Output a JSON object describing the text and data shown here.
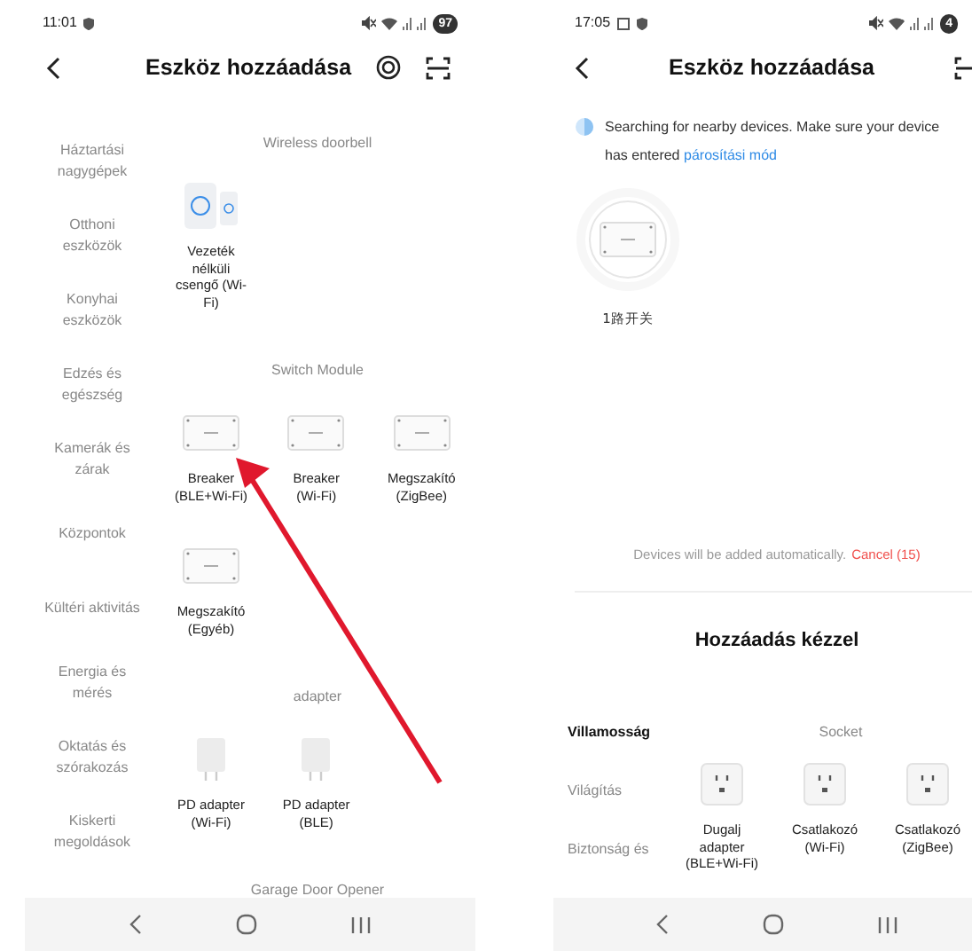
{
  "left_screen": {
    "status_bar": {
      "time": "11:01",
      "battery": "97"
    },
    "title": "Eszköz hozzáadása",
    "categories": [
      {
        "label": "Háztartási nagygépek",
        "selected": false
      },
      {
        "label": "Otthoni eszközök",
        "selected": false
      },
      {
        "label": "Konyhai eszközök",
        "selected": false
      },
      {
        "label": "Edzés és egészség",
        "selected": false
      },
      {
        "label": "Kamerák és zárak",
        "selected": false
      },
      {
        "label": "Központok",
        "selected": false
      },
      {
        "label": "Kültéri aktivitás",
        "selected": false
      },
      {
        "label": "Energia és mérés",
        "selected": false
      },
      {
        "label": "Oktatás és szórakozás",
        "selected": false
      },
      {
        "label": "Kiskerti megoldások",
        "selected": false
      }
    ],
    "sections": [
      {
        "title": "Wireless doorbell",
        "items": [
          {
            "label": "Vezeték nélküli csengő (Wi-Fi)",
            "kind": "doorbell"
          }
        ]
      },
      {
        "title": "Switch Module",
        "items": [
          {
            "label": "Breaker (BLE+Wi-Fi)",
            "kind": "breaker"
          },
          {
            "label": "Breaker (Wi-Fi)",
            "kind": "breaker"
          },
          {
            "label": "Megszakító (ZigBee)",
            "kind": "breaker"
          },
          {
            "label": "Megszakító (Egyéb)",
            "kind": "breaker"
          }
        ]
      },
      {
        "title": "adapter",
        "items": [
          {
            "label": "PD adapter (Wi-Fi)",
            "kind": "adapter"
          },
          {
            "label": "PD adapter (BLE)",
            "kind": "adapter"
          }
        ]
      },
      {
        "title": "Garage Door Opener"
      }
    ]
  },
  "right_screen": {
    "status_bar": {
      "time": "17:05",
      "battery": "4"
    },
    "title": "Eszköz hozzáadása",
    "search_message": "Searching for nearby devices. Make sure your device has entered",
    "pairing_link": "párosítási mód",
    "found_devices": [
      {
        "label": "1路开关"
      }
    ],
    "auto_add_text": "Devices will be added automatically.",
    "cancel_link": "Cancel (15)",
    "manual_heading": "Hozzáadás kézzel",
    "categories": [
      {
        "label": "Villamosság",
        "selected": true
      },
      {
        "label": "Világítás",
        "selected": false
      },
      {
        "label": "Biztonság és",
        "selected": false
      }
    ],
    "sections": [
      {
        "title": "Socket",
        "items": [
          {
            "label": "Dugalj adapter (BLE+Wi-Fi)",
            "kind": "socket"
          },
          {
            "label": "Csatlakozó (Wi-Fi)",
            "kind": "socket"
          },
          {
            "label": "Csatlakozó (ZigBee)",
            "kind": "socket"
          }
        ]
      }
    ]
  }
}
